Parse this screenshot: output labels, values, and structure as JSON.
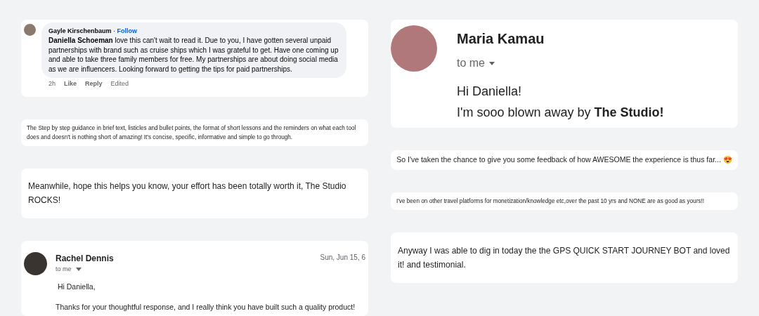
{
  "left_column": [
    {
      "kind": "comment",
      "author": "Gayle Kirschenbaum",
      "separator": "·",
      "follow": "Follow",
      "body": "**Daniella Schoeman** love this can't wait to read it. Due to you, I have gotten several unpaid partnerships with brand such as cruise ships which I was grateful to get. Have one coming up and able to take three family members for free. My partnerships are about doing social media as we are influencers. Looking forward to getting the tips for paid partnerships.",
      "actions": [
        "2h",
        "Like",
        "Reply",
        "Edited"
      ]
    },
    {
      "kind": "fine_print",
      "text": "The Step by step guidance in brief text, listicles and bullet points, the format of short lessons and the reminders on what each tool does and doesn't is nothing short of amazing! It's concise, specific, informative and simple to go through."
    },
    {
      "kind": "text",
      "text": "Meanwhile, hope this helps you know, your effort has been totally worth it, The Studio ROCKS!"
    },
    {
      "kind": "email",
      "sender": "Rachel Dennis",
      "recipient": "to me",
      "date": "Sun, Jun 15, 6",
      "lines": [
        " Hi Daniella,",
        "Thanks for your thoughtful response, and I really think you have built such a quality product!"
      ]
    }
  ],
  "right_column": [
    {
      "kind": "large_email",
      "sender": "Maria Kamau",
      "recipient": "to me",
      "lines": [
        "Hi Daniella!",
        "I'm sooo blown away by **The Studio!**"
      ]
    },
    {
      "kind": "centered",
      "text": "So I've taken the chance to give you some feedback of how AWESOME the experience is thus far... 😍"
    },
    {
      "kind": "fine_print",
      "text": "I've been on other travel platforms for monetization/knowledge etc,over the past 10 yrs and NONE are as good as yours!!"
    },
    {
      "kind": "text",
      "text": "Anyway I was able to dig in today the the GPS QUICK START JOURNEY BOT and loved it! and testimonial."
    }
  ]
}
